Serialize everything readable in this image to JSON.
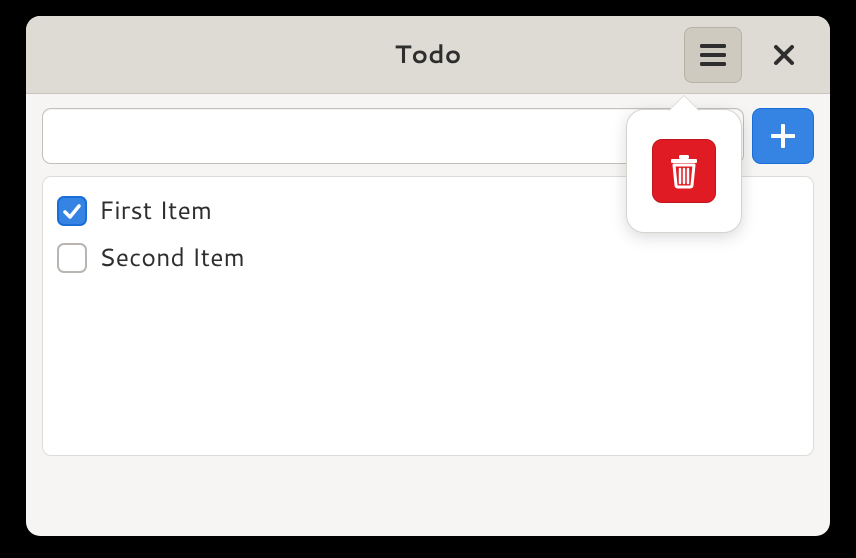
{
  "window": {
    "title": "Todo"
  },
  "input": {
    "value": "",
    "placeholder": ""
  },
  "items": [
    {
      "label": "First Item",
      "checked": true
    },
    {
      "label": "Second Item",
      "checked": false
    }
  ]
}
